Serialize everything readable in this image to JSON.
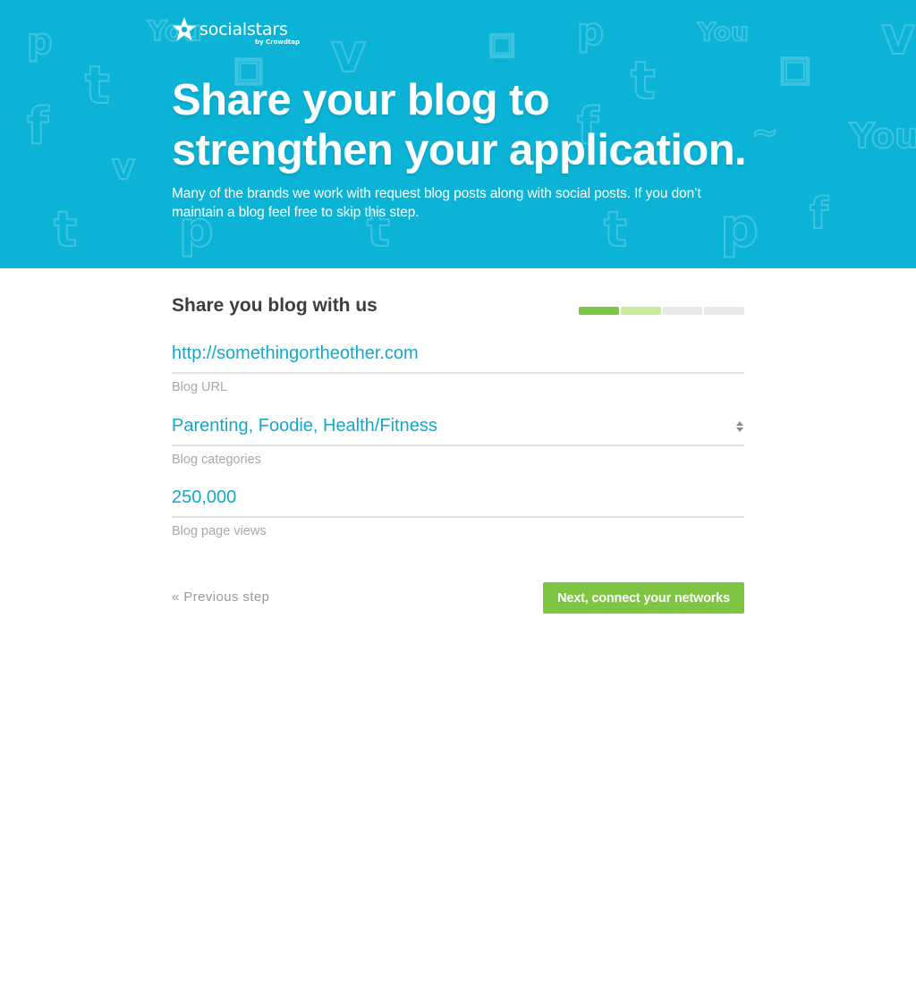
{
  "brand": {
    "name": "socialstars",
    "byline": "by Crowdtap"
  },
  "hero": {
    "title_line1": "Share your blog to",
    "title_line2": "strengthen your application.",
    "description": "Many of the brands we work with request blog posts along with social posts. If you don’t maintain a blog feel free to skip this step.",
    "background_color": "#0bb3d6"
  },
  "form": {
    "section_title": "Share you blog with us",
    "progress": {
      "total_steps": 4,
      "completed": 1,
      "current": 2,
      "completed_color": "#7dc542",
      "current_color": "#c9eb9e",
      "pending_color": "#e8e8e8"
    },
    "fields": [
      {
        "value": "http://somethingortheother.com",
        "label": "Blog URL"
      },
      {
        "value": "Parenting, Foodie, Health/Fitness",
        "label": "Blog categories"
      },
      {
        "value": "250,000",
        "label": "Blog page views"
      }
    ],
    "previous_label": "« Previous step",
    "next_label": "Next, connect your networks"
  },
  "icons": {
    "logo": "star-logo-icon",
    "select_arrows": "select-arrows-icon",
    "background": "social-network-pattern"
  },
  "colors": {
    "accent": "#12a8cc",
    "button": "#7dc542",
    "label": "#a8a8a8"
  }
}
